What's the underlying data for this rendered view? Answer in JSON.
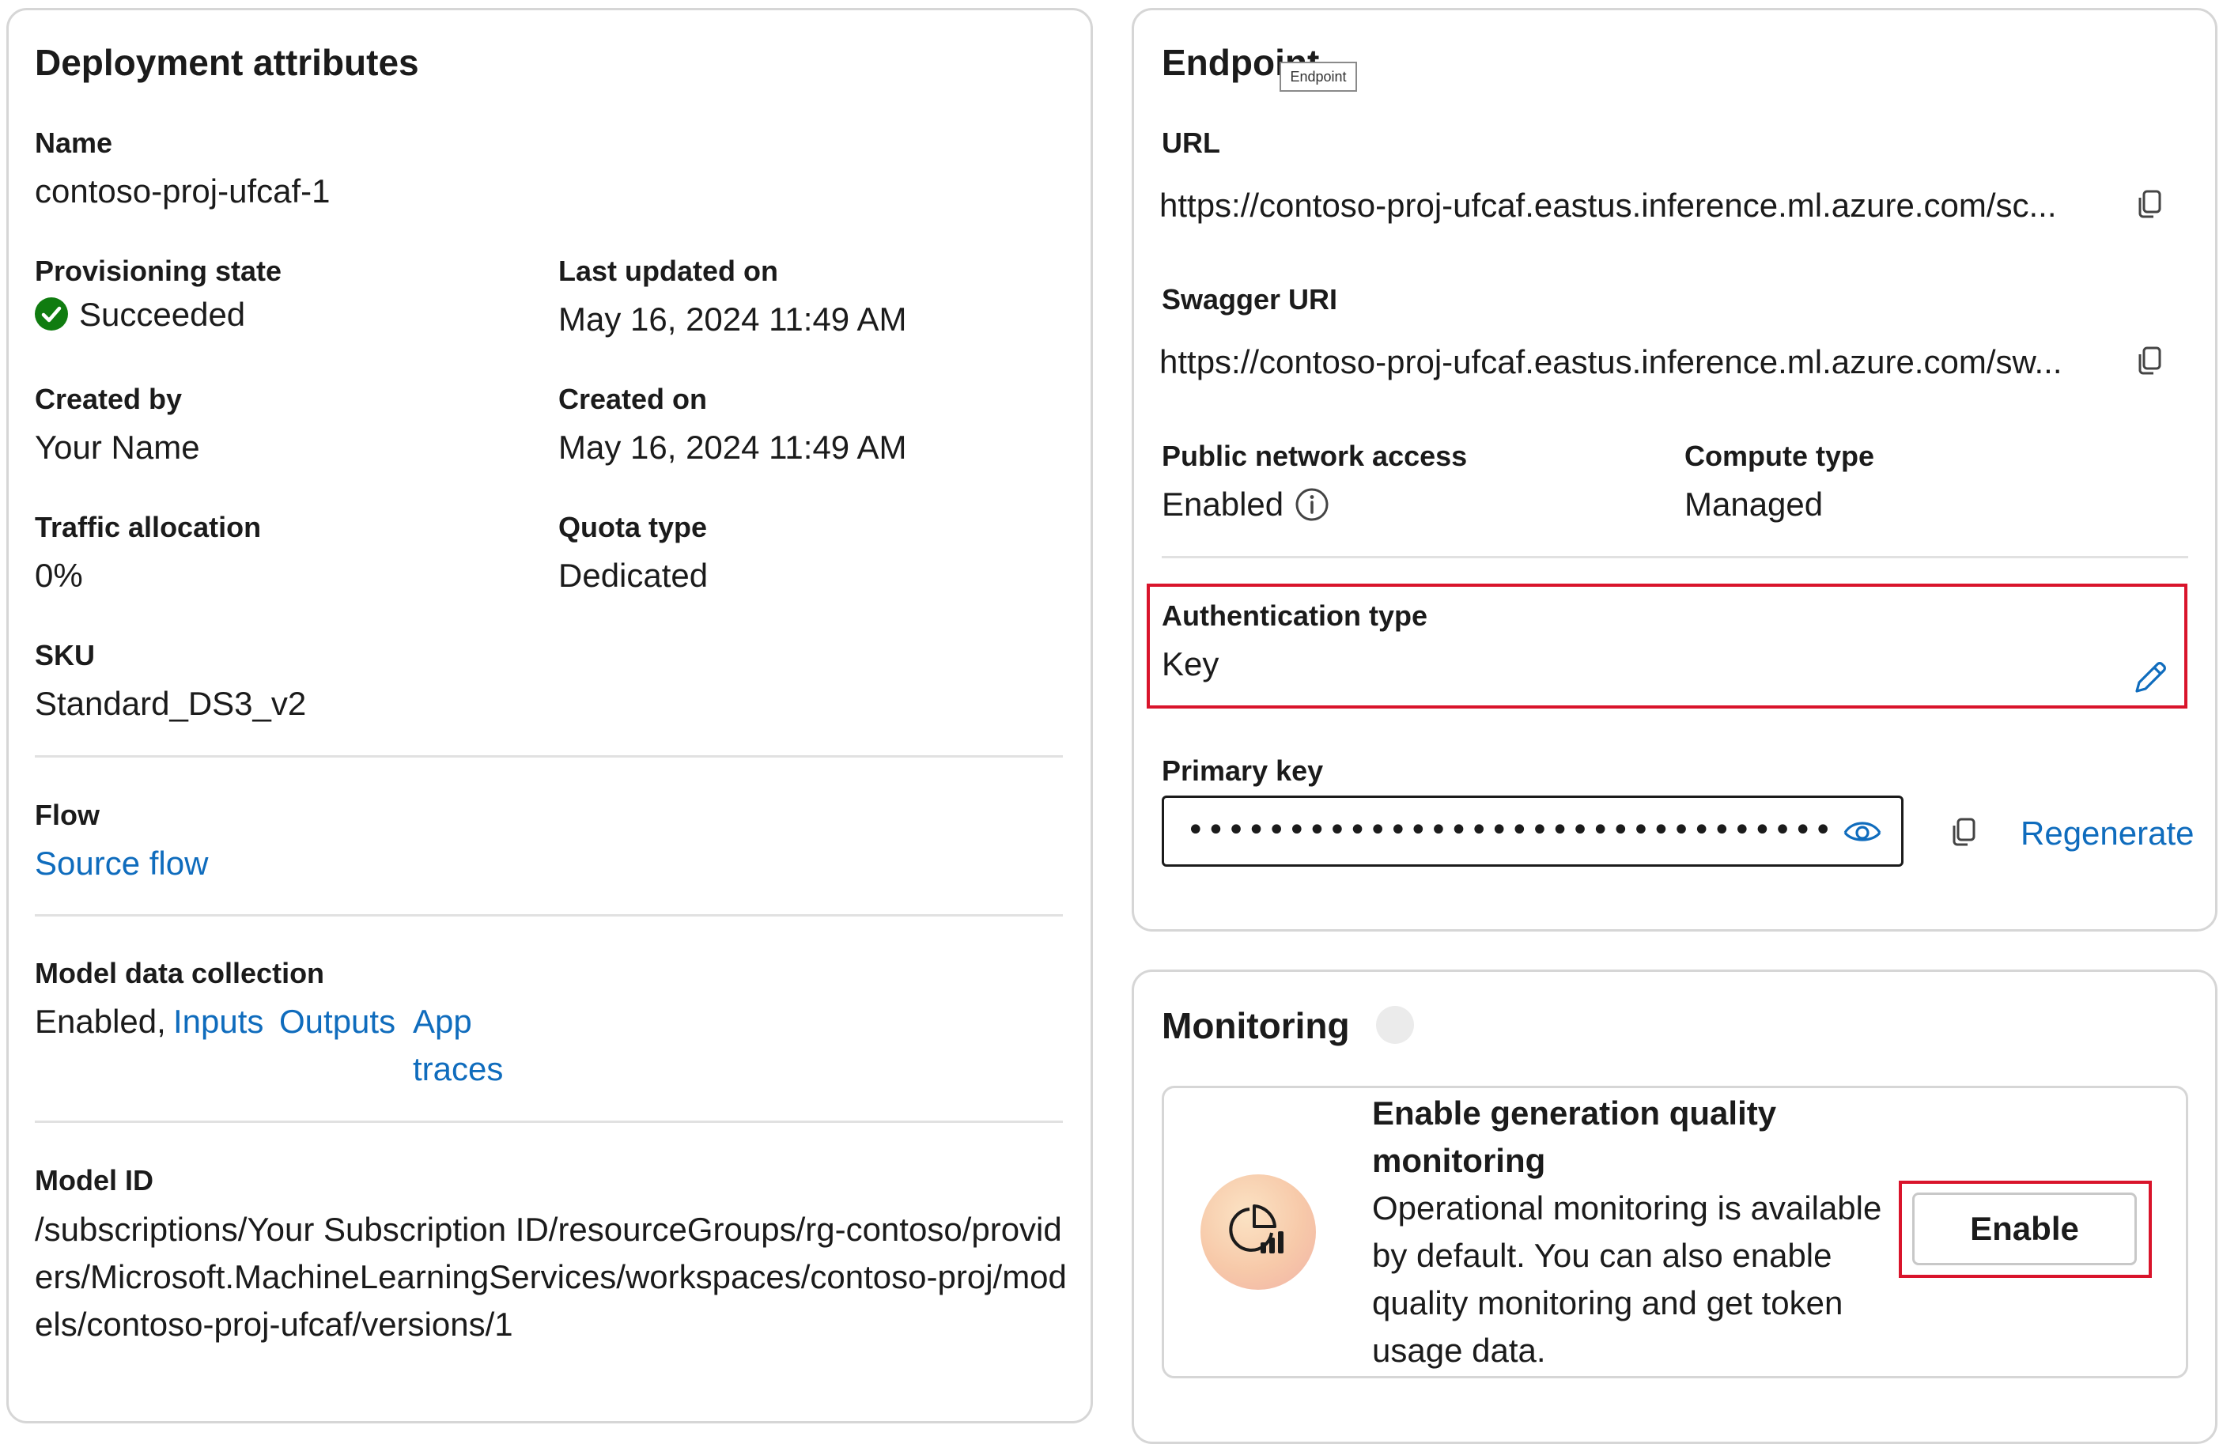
{
  "deployment": {
    "title": "Deployment attributes",
    "name_label": "Name",
    "name_value": "contoso-proj-ufcaf-1",
    "provisioning_label": "Provisioning state",
    "provisioning_value": "Succeeded",
    "last_updated_label": "Last updated on",
    "last_updated_value": "May 16, 2024 11:49 AM",
    "created_by_label": "Created by",
    "created_by_value": "Your Name",
    "created_on_label": "Created on",
    "created_on_value": "May 16, 2024 11:49 AM",
    "traffic_label": "Traffic allocation",
    "traffic_value": "0%",
    "quota_label": "Quota type",
    "quota_value": "Dedicated",
    "sku_label": "SKU",
    "sku_value": "Standard_DS3_v2",
    "flow_label": "Flow",
    "flow_link": "Source flow",
    "mdc_label": "Model data collection",
    "mdc_value": "Enabled,",
    "mdc_inputs": "Inputs",
    "mdc_outputs": "Outputs",
    "mdc_app": "App",
    "mdc_traces": "traces",
    "model_id_label": "Model ID",
    "model_id_value": "/subscriptions/Your Subscription ID/resourceGroups/rg-contoso/providers/Microsoft.MachineLearningServices/workspaces/contoso-proj/models/contoso-proj-ufcaf/versions/1"
  },
  "endpoint": {
    "title": "Endpoint",
    "tooltip": "Endpoint",
    "url_label": "URL",
    "url_value": "https://contoso-proj-ufcaf.eastus.inference.ml.azure.com/sc...",
    "swagger_label": "Swagger URI",
    "swagger_value": "https://contoso-proj-ufcaf.eastus.inference.ml.azure.com/sw...",
    "public_access_label": "Public network access",
    "public_access_value": "Enabled",
    "compute_label": "Compute type",
    "compute_value": "Managed",
    "auth_label": "Authentication type",
    "auth_value": "Key",
    "primary_key_label": "Primary key",
    "primary_key_masked": "••••••••••••••••••••••••••••••••",
    "regenerate": "Regenerate"
  },
  "monitoring": {
    "title": "Monitoring",
    "card_title": "Enable generation quality monitoring",
    "card_desc": "Operational monitoring is available by default. You can also enable quality monitoring and get token usage data.",
    "enable_button": "Enable"
  },
  "colors": {
    "accent": "#0f6cbd",
    "success": "#107c10",
    "highlight": "#d9142b"
  }
}
